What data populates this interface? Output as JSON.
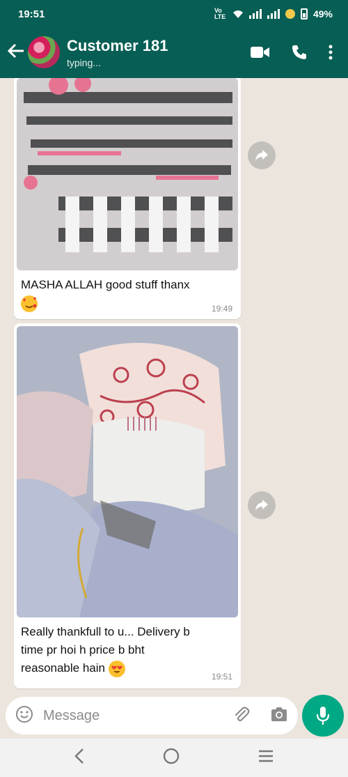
{
  "status_bar": {
    "time": "19:51",
    "network": "Vo LTE",
    "battery": "49%"
  },
  "header": {
    "contact_name": "Customer 181",
    "presence": "typing..."
  },
  "messages": [
    {
      "caption": "MASHA ALLAH good stuff thanx",
      "emoji_icon": "smiling-face-with-hearts-icon",
      "time": "19:49"
    },
    {
      "caption": "Really thankfull to u... Delivery b time pr hoi h price b bht reasonable hain",
      "emoji_icon": "heart-eyes-icon",
      "time": "19:51"
    }
  ],
  "composer": {
    "placeholder": "Message"
  },
  "colors": {
    "header": "#075e54",
    "chat_bg": "#ece5dd",
    "mic": "#00a884"
  }
}
